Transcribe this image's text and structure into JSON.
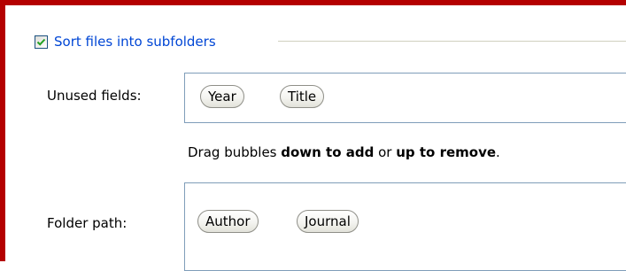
{
  "sort_option": {
    "label": "Sort files into subfolders",
    "checked": true,
    "accent_color": "#0046d5"
  },
  "unused_fields": {
    "label": "Unused fields:",
    "bubbles": [
      "Year",
      "Title"
    ]
  },
  "hint": {
    "prefix": "Drag bubbles ",
    "emphasis_1": "down to add",
    "middle": " or ",
    "emphasis_2": "up to remove",
    "suffix": "."
  },
  "folder_path": {
    "label": "Folder path:",
    "bubbles": [
      "Author",
      "Journal"
    ]
  },
  "colors": {
    "window_border": "#b40000",
    "area_border": "#7f9db9"
  }
}
